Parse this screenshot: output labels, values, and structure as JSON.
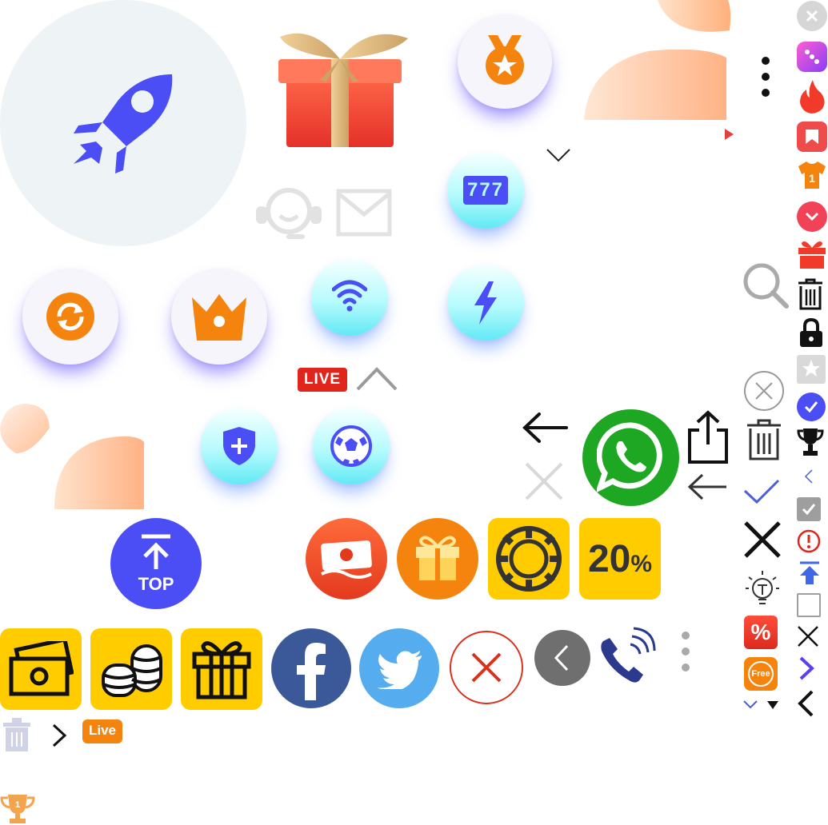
{
  "badges": {
    "live_red": "LIVE",
    "live_orange": "Live",
    "top": "TOP",
    "percent20": "20",
    "percent_sign": "%",
    "slots": "777",
    "free": "Free",
    "discount": "%",
    "trophy_rank": "1",
    "shirt_number": "1"
  },
  "colors": {
    "primary_purple": "#4b4ef5",
    "cyan": "#62e9f5",
    "orange": "#f5840f",
    "red": "#e0261c",
    "yellow": "#ffcc00",
    "facebook": "#3b5998",
    "twitter": "#55acee",
    "whatsapp": "#1ea723",
    "grey": "#6f6f6f"
  },
  "icons": [
    "rocket-icon",
    "gift-box-icon",
    "medal-icon",
    "slots-777-icon",
    "support-agent-icon",
    "mail-icon",
    "refresh-icon",
    "crown-icon",
    "wifi-icon",
    "lightning-icon",
    "shield-plus-icon",
    "soccer-ball-icon",
    "back-to-top-icon",
    "money-bill-icon",
    "gift-icon",
    "poker-chip-icon",
    "percent-20-icon",
    "cash-icon",
    "coins-icon",
    "gift-outline-icon",
    "facebook-icon",
    "twitter-icon",
    "close-circle-icon",
    "back-circle-icon",
    "phone-ringing-icon",
    "whatsapp-icon",
    "share-icon",
    "search-icon",
    "trash-icon",
    "lock-icon",
    "star-icon",
    "check-circle-icon",
    "trophy-icon",
    "checkbox-icon",
    "alert-icon",
    "upload-icon",
    "empty-checkbox-icon",
    "close-icon",
    "chevron-right-icon",
    "chevron-left-icon",
    "discount-icon",
    "free-icon",
    "lightbulb-icon",
    "kebab-menu-icon",
    "dice-icon",
    "fire-icon",
    "bookmark-icon",
    "shirt-icon",
    "chevron-down-circle-icon",
    "gift-red-icon"
  ]
}
